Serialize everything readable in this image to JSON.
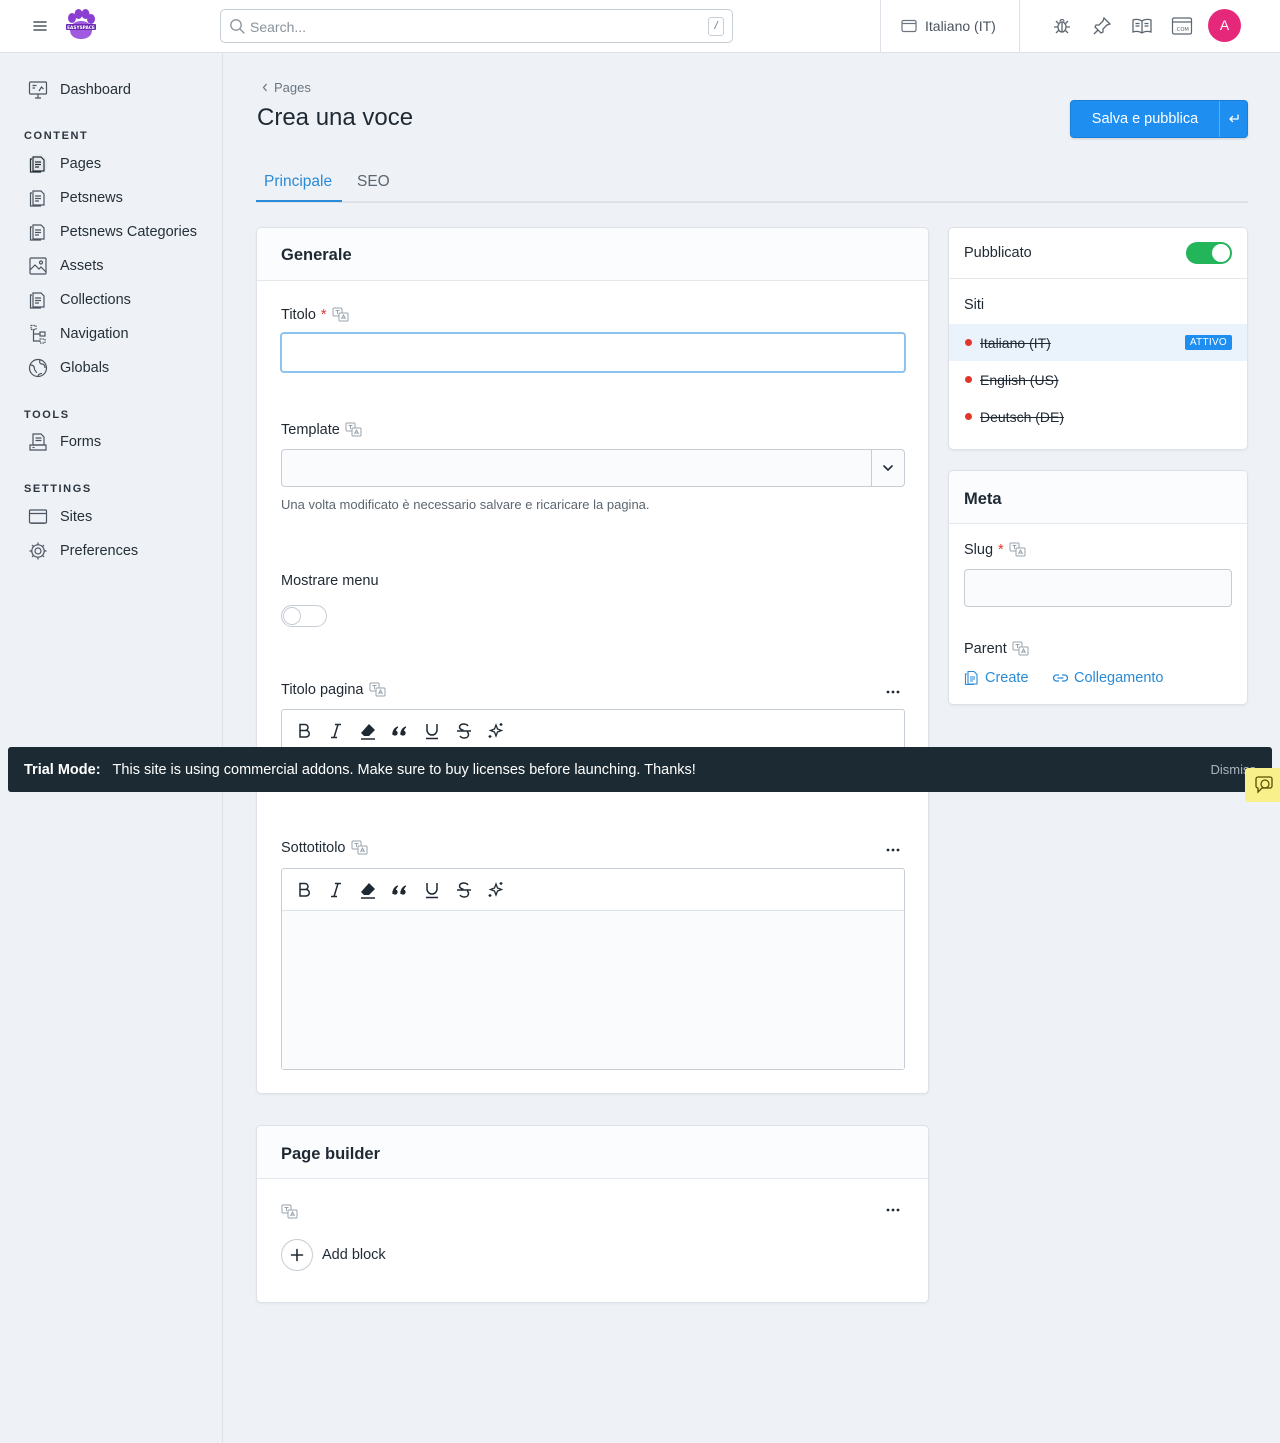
{
  "header": {
    "search_placeholder": "Search...",
    "search_shortcut": "/",
    "site_selector": "Italiano (IT)",
    "avatar_initial": "A",
    "logo_text": "EASYSPACE"
  },
  "sidebar": {
    "dashboard": "Dashboard",
    "content_heading": "CONTENT",
    "content_items": [
      "Pages",
      "Petsnews",
      "Petsnews Categories",
      "Assets",
      "Collections",
      "Navigation",
      "Globals"
    ],
    "tools_heading": "TOOLS",
    "tools_items": [
      "Forms"
    ],
    "settings_heading": "SETTINGS",
    "settings_items": [
      "Sites",
      "Preferences"
    ]
  },
  "page": {
    "breadcrumb": "Pages",
    "title": "Crea una voce",
    "save_button": "Salva e pubblica",
    "tabs": [
      "Principale",
      "SEO"
    ]
  },
  "generale": {
    "heading": "Generale",
    "titolo_label": "Titolo",
    "titolo_value": "",
    "template_label": "Template",
    "template_value": "",
    "template_help": "Una volta modificato è necessario salvare e ricaricare la pagina.",
    "mostrare_menu_label": "Mostrare menu",
    "mostrare_menu_on": false,
    "titolo_pagina_label": "Titolo pagina",
    "sottotitolo_label": "Sottotitolo",
    "required_mark": "*"
  },
  "page_builder": {
    "heading": "Page builder",
    "add_block": "Add block"
  },
  "publish": {
    "label": "Pubblicato",
    "published": true,
    "sites_heading": "Siti",
    "sites": [
      {
        "name": "Italiano (IT)",
        "badge": "ATTIVO"
      },
      {
        "name": "English (US)",
        "badge": ""
      },
      {
        "name": "Deutsch (DE)",
        "badge": ""
      }
    ]
  },
  "meta": {
    "heading": "Meta",
    "slug_label": "Slug",
    "parent_label": "Parent",
    "create_label": "Create",
    "link_label": "Collegamento"
  },
  "trial": {
    "label": "Trial Mode:",
    "message": "This site is using commercial addons. Make sure to buy licenses before launching. Thanks!",
    "dismiss": "Dismiss"
  },
  "colors": {
    "accent": "#1f8ef1",
    "toggle_on": "#22b55a",
    "required": "#e0362c",
    "avatar": "#e5287a",
    "trial_bg": "#1c2b33"
  }
}
